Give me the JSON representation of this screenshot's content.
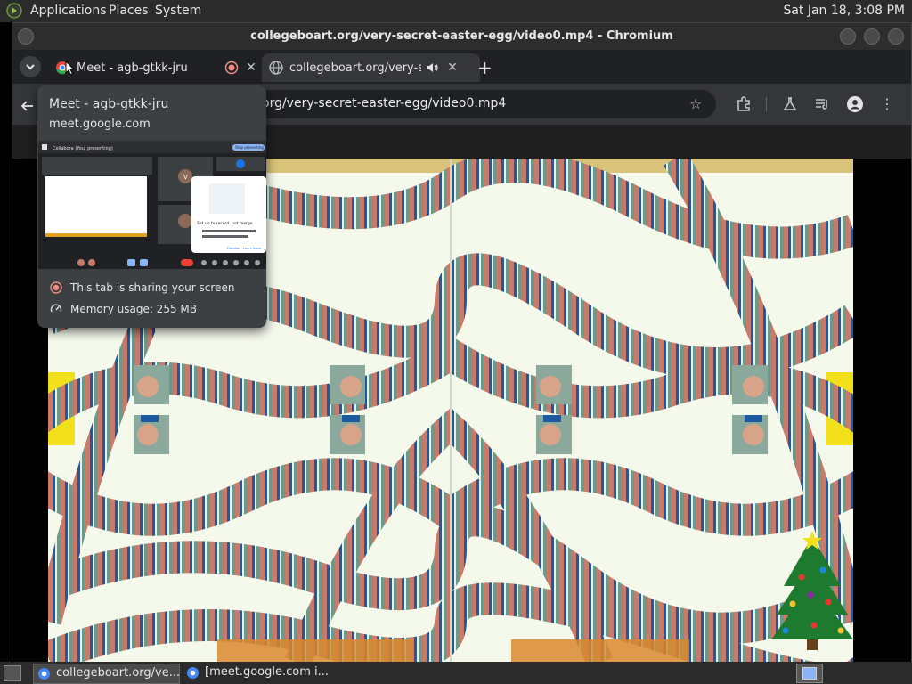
{
  "top_panel": {
    "menus": [
      "Applications",
      "Places",
      "System"
    ],
    "clock": "Sat Jan 18,  3:08 PM"
  },
  "window": {
    "title": "collegeboart.org/very-secret-easter-egg/video0.mp4 - Chromium"
  },
  "tabs": [
    {
      "label": "Meet - agb-gtkk-jru",
      "recording": true,
      "active": false
    },
    {
      "label": "collegeboart.org/very-se",
      "audio": true,
      "active": true
    }
  ],
  "toolbar": {
    "address_text": "org/very-secret-easter-egg/video0.mp4"
  },
  "hover_card": {
    "title": "Meet - agb-gtkk-jru",
    "domain": "meet.google.com",
    "preview": {
      "header_text": "Collabora (You, presenting)",
      "share_button": "Stop presenting",
      "dialog_title": "Set up to record, not merge",
      "dialog_text": "Want to record? Recording is only with a Google One Premium plan",
      "dialog_dismiss": "Dismiss",
      "dialog_learn": "Learn more",
      "tile_initial": "V"
    },
    "sharing_text": "This tab is sharing your screen",
    "memory_text": "Memory usage: 255 MB"
  },
  "taskbar": {
    "items": [
      {
        "label": "collegeboart.org/ve...",
        "active": true
      },
      {
        "label": "[meet.google.com i...",
        "active": false
      }
    ]
  },
  "colors": {
    "panel_bg": "#2b2b2b",
    "tab_active": "#35363a",
    "record_red": "#f28b82",
    "video_cream": "#f5f9ec",
    "pattern_teal": "#6b9a8a",
    "pattern_blue": "#1e5aa0",
    "pattern_salmon": "#c97a6a",
    "border_yellow": "#f2e11a"
  }
}
